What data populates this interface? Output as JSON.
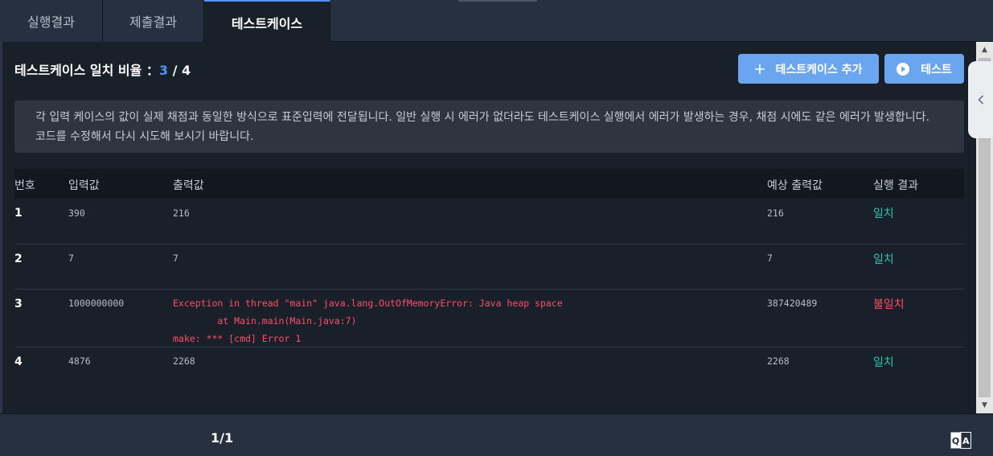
{
  "tabs": [
    {
      "label": "실행결과"
    },
    {
      "label": "제출결과"
    },
    {
      "label": "테스트케이스"
    }
  ],
  "ratio": {
    "label": "테스트케이스 일치 비율 ：",
    "matched": "3",
    "separator": " / ",
    "total": "4"
  },
  "buttons": {
    "add_testcase": "테스트케이스 추가",
    "test": "테스트"
  },
  "notice": "각 입력 케이스의 값이 실제 채점과 동일한 방식으로 표준입력에 전달됩니다. 일반 실행 시 에러가 없더라도 테스트케이스 실행에서 에러가 발생하는 경우, 채점 시에도 같은 에러가 발생합니다. 코드를 수정해서 다시 시도해 보시기 바랍니다.",
  "table": {
    "headers": {
      "no": "번호",
      "input": "입력값",
      "output": "출력값",
      "expected": "예상 출력값",
      "result": "실행 결과"
    },
    "rows": [
      {
        "no": "1",
        "input": "390",
        "output": "216",
        "expected": "216",
        "result": "일치"
      },
      {
        "no": "2",
        "input": "7",
        "output": "7",
        "expected": "7",
        "result": "일치"
      },
      {
        "no": "3",
        "input": "1000000000",
        "output": "Exception in thread \"main\" java.lang.OutOfMemoryError: Java heap space\n        at Main.main(Main.java:7)\nmake: *** [cmd] Error 1",
        "expected": "387420489",
        "result": "불일치"
      },
      {
        "no": "4",
        "input": "4876",
        "output": "2268",
        "expected": "2268",
        "result": "일치"
      }
    ]
  },
  "pagination": "1/1",
  "colors": {
    "accent": "#4d94ff",
    "button": "#69a6ef",
    "match": "#2bc4b4",
    "mismatch": "#ff4d6a"
  },
  "icons": [
    "plus-icon",
    "play-icon",
    "chevron-left-icon",
    "qa-icon"
  ]
}
